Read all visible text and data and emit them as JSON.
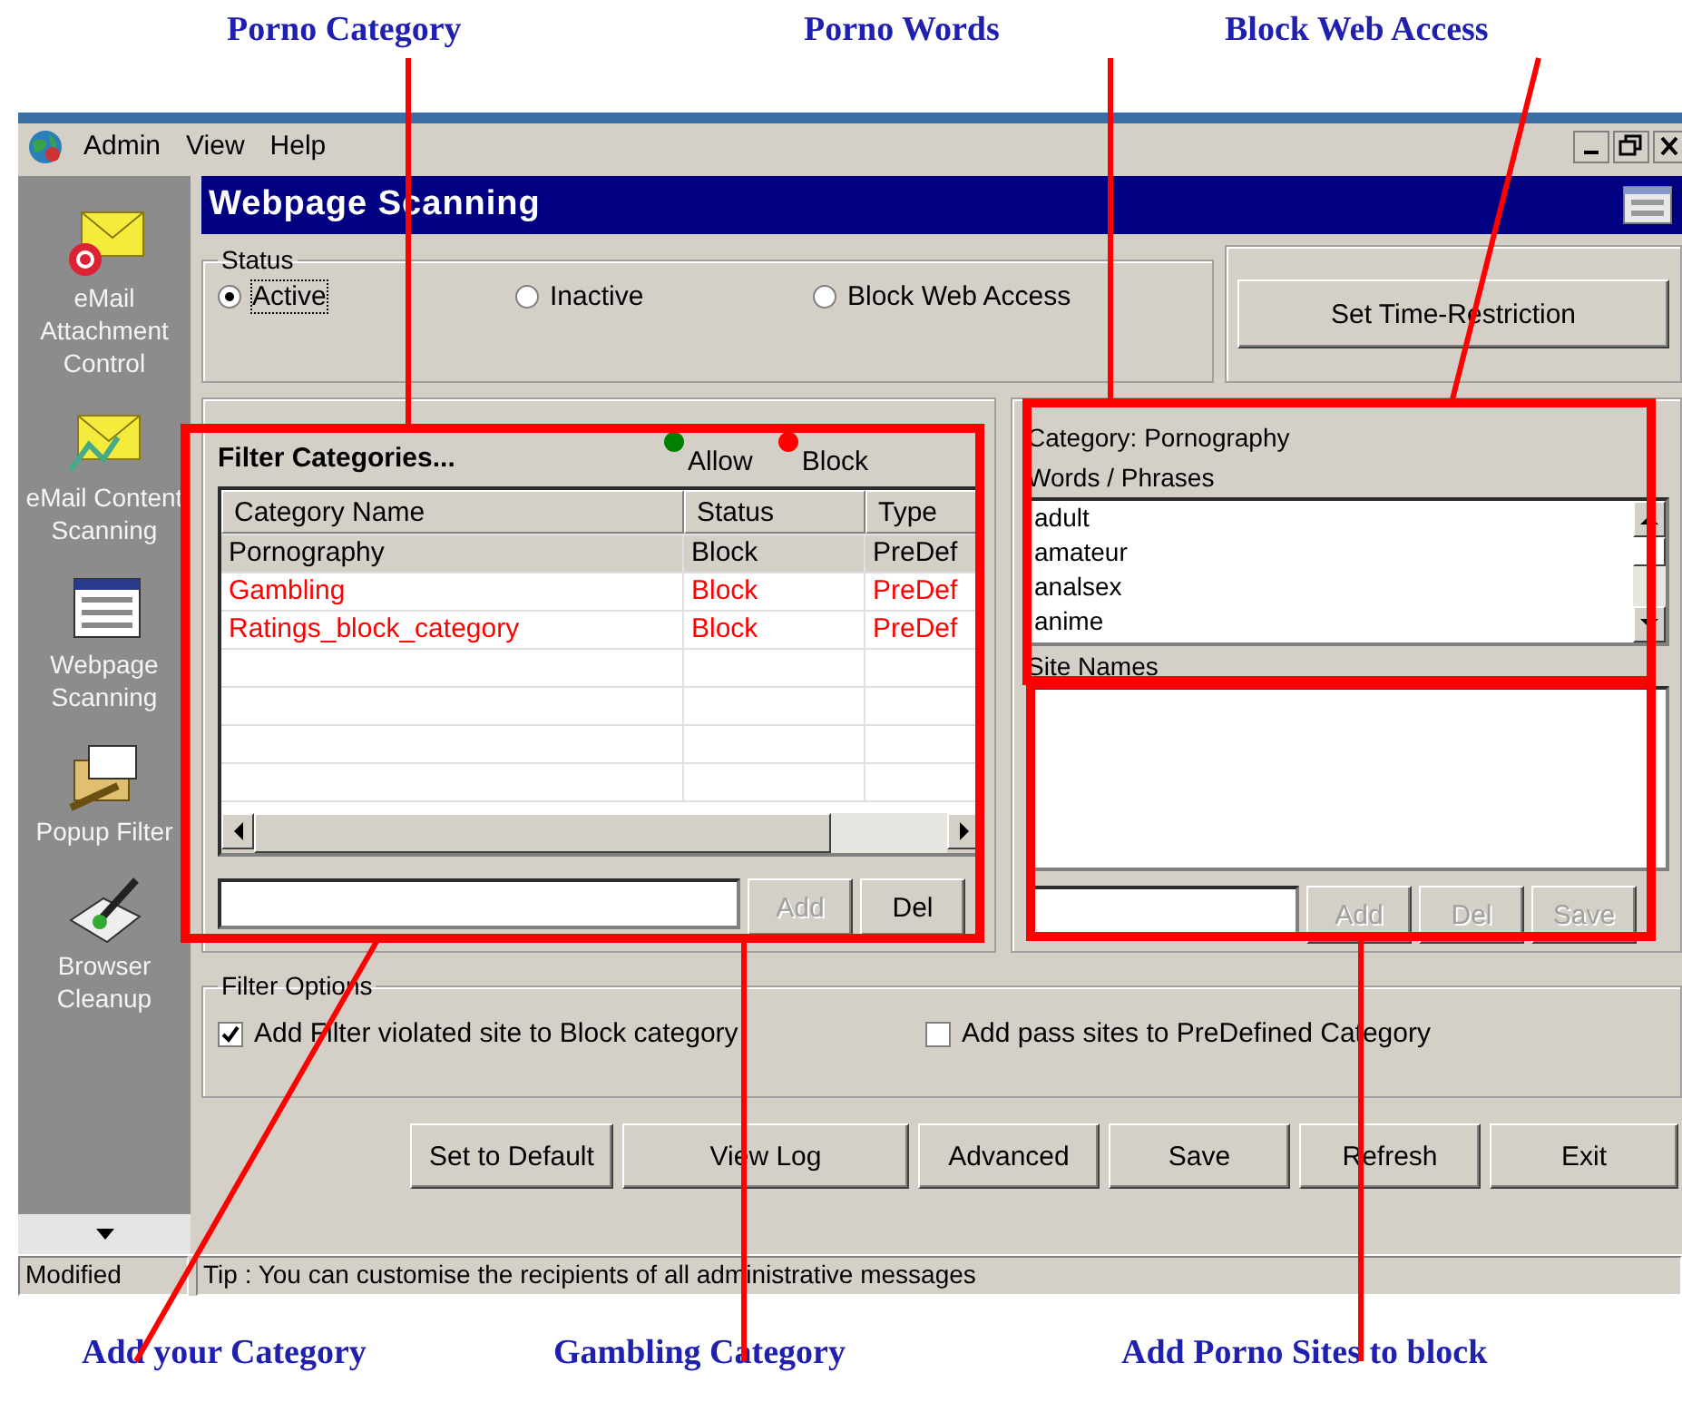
{
  "annotations": {
    "top": [
      "Porno Category",
      "Porno Words",
      "Block Web Access"
    ],
    "bottom": [
      "Add your Category",
      "Gambling Category",
      "Add Porno Sites to block"
    ]
  },
  "menu": [
    "Admin",
    "View",
    "Help"
  ],
  "sidebar": {
    "items": [
      {
        "label": "eMail Attachment Control",
        "kind": "attachment"
      },
      {
        "label": "eMail Content Scanning",
        "kind": "content"
      },
      {
        "label": "Webpage Scanning",
        "kind": "webpage"
      },
      {
        "label": "Popup Filter",
        "kind": "popup"
      },
      {
        "label": "Browser Cleanup",
        "kind": "cleanup"
      }
    ]
  },
  "header": {
    "title": "Webpage Scanning"
  },
  "status": {
    "title": "Status",
    "options": [
      {
        "label": "Active",
        "selected": true
      },
      {
        "label": "Inactive",
        "selected": false
      },
      {
        "label": "Block Web Access",
        "selected": false
      }
    ],
    "button": "Set Time-Restriction"
  },
  "filter_categories": {
    "title": "Filter Categories...",
    "legend": [
      {
        "label": "Allow",
        "color": "#008000"
      },
      {
        "label": "Block",
        "color": "#ff0000"
      }
    ],
    "columns": [
      "Category Name",
      "Status",
      "Type"
    ],
    "rows": [
      {
        "cells": [
          "Pornography",
          "Block",
          "PreDef"
        ],
        "color": "#000000",
        "selected": true
      },
      {
        "cells": [
          "Gambling",
          "Block",
          "PreDef"
        ],
        "color": "#ff0000",
        "selected": false
      },
      {
        "cells": [
          "Ratings_block_category",
          "Block",
          "PreDef"
        ],
        "color": "#ff0000",
        "selected": false
      }
    ],
    "buttons": [
      {
        "label": "Add",
        "disabled": true
      },
      {
        "label": "Del",
        "disabled": false
      }
    ]
  },
  "category_panel": {
    "category": "Category: Pornography",
    "words_label": "Words / Phrases",
    "words": [
      "adult",
      "amateur",
      "analsex",
      "anime"
    ],
    "sites_label": "Site Names",
    "buttons": [
      {
        "label": "Add",
        "disabled": true
      },
      {
        "label": "Del",
        "disabled": true
      },
      {
        "label": "Save",
        "disabled": true
      }
    ]
  },
  "filter_options": {
    "title": "Filter Options",
    "options": [
      {
        "label": "Add Filter violated site to Block category",
        "checked": true
      },
      {
        "label": "Add pass sites to PreDefined Category",
        "checked": false
      }
    ]
  },
  "buttons": [
    "Set to Default",
    "View Log",
    "Advanced",
    "Save",
    "Refresh",
    "Exit"
  ],
  "status_bar": [
    "Modified",
    "Tip : You can customise the recipients of all administrative messages"
  ]
}
